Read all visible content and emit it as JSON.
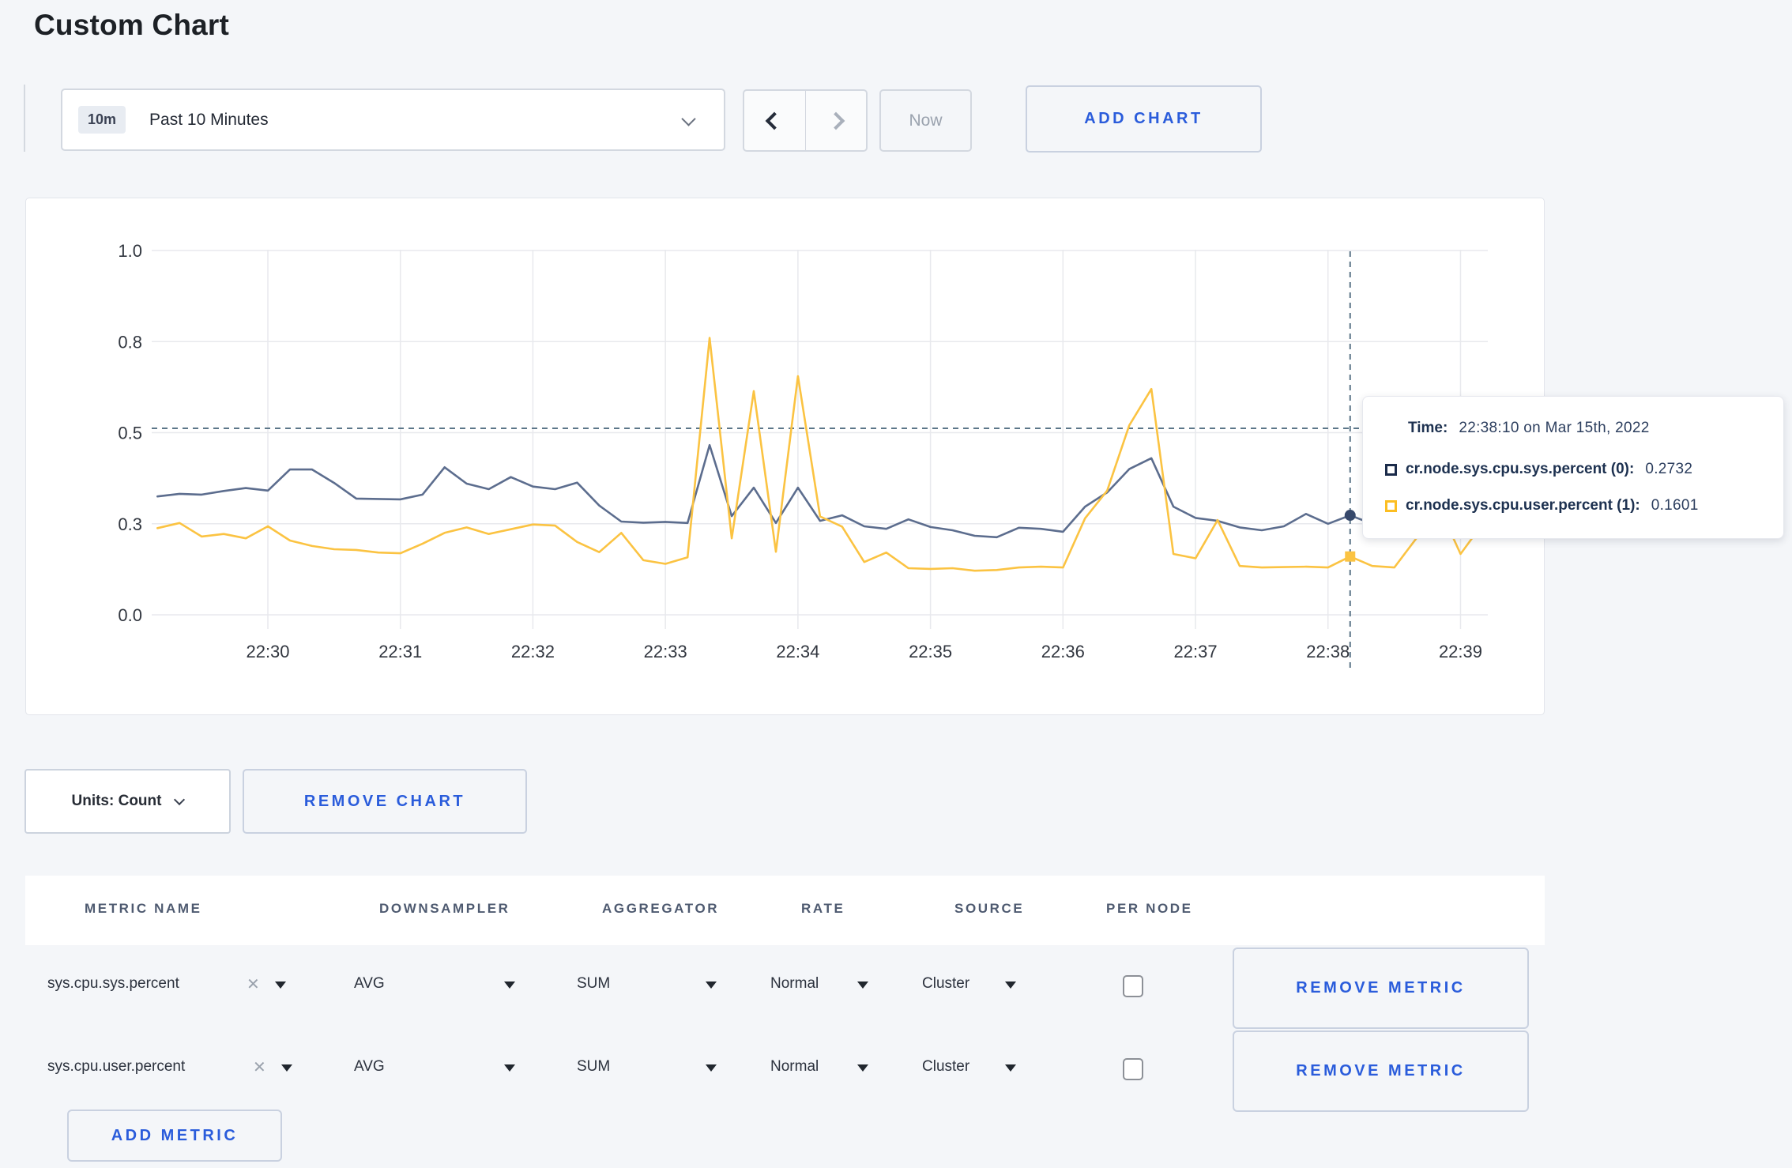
{
  "page": {
    "title": "Custom Chart"
  },
  "toolbar": {
    "time_window_badge": "10m",
    "time_window_label": "Past 10 Minutes",
    "prev_icon": "chevron-left-icon",
    "next_icon": "chevron-right-icon",
    "now_label": "Now",
    "add_chart_label": "ADD CHART"
  },
  "chart_data": {
    "type": "line",
    "title": "",
    "xlabel": "",
    "ylabel": "",
    "x_start_time": "22:29:10",
    "x_end_time": "22:39:10",
    "sample_interval_seconds": 10,
    "x_tick_labels": [
      "22:30",
      "22:31",
      "22:32",
      "22:33",
      "22:34",
      "22:35",
      "22:36",
      "22:37",
      "22:38",
      "22:39"
    ],
    "y_ticks": [
      {
        "label": "0.0",
        "value": 0.0
      },
      {
        "label": "0.3",
        "value": 0.25
      },
      {
        "label": "0.5",
        "value": 0.5
      },
      {
        "label": "0.8",
        "value": 0.75
      },
      {
        "label": "1.0",
        "value": 1.0
      }
    ],
    "ylim": [
      0,
      1
    ],
    "grid": true,
    "legend_position": "tooltip",
    "hover": {
      "index": 54,
      "time": "22:38:10",
      "crosshair_y_value": 0.512
    },
    "series": [
      {
        "name": "cr.node.sys.cpu.sys.percent (0)",
        "color": "#5c6d8e",
        "marker_color": "#36486b",
        "marker_shape": "circle",
        "hover_value": 0.2732,
        "values": [
          0.325,
          0.332,
          0.33,
          0.34,
          0.348,
          0.341,
          0.399,
          0.399,
          0.362,
          0.319,
          0.318,
          0.317,
          0.33,
          0.405,
          0.36,
          0.345,
          0.378,
          0.352,
          0.345,
          0.363,
          0.3,
          0.256,
          0.253,
          0.255,
          0.252,
          0.466,
          0.271,
          0.349,
          0.252,
          0.349,
          0.258,
          0.273,
          0.243,
          0.236,
          0.262,
          0.241,
          0.232,
          0.217,
          0.213,
          0.239,
          0.236,
          0.228,
          0.297,
          0.336,
          0.4,
          0.43,
          0.297,
          0.266,
          0.258,
          0.24,
          0.232,
          0.243,
          0.277,
          0.25,
          0.2732,
          0.25,
          0.268,
          0.288,
          0.3,
          0.29,
          0.308
        ]
      },
      {
        "name": "cr.node.sys.cpu.user.percent (1)",
        "color": "#fbc342",
        "marker_color": "#fbc342",
        "marker_shape": "square",
        "hover_value": 0.1601,
        "values": [
          0.238,
          0.252,
          0.215,
          0.222,
          0.21,
          0.243,
          0.204,
          0.189,
          0.18,
          0.178,
          0.171,
          0.169,
          0.195,
          0.225,
          0.24,
          0.222,
          0.235,
          0.248,
          0.245,
          0.2,
          0.172,
          0.225,
          0.15,
          0.14,
          0.158,
          0.76,
          0.21,
          0.614,
          0.173,
          0.655,
          0.27,
          0.242,
          0.145,
          0.171,
          0.128,
          0.126,
          0.128,
          0.121,
          0.123,
          0.13,
          0.132,
          0.13,
          0.265,
          0.341,
          0.52,
          0.62,
          0.167,
          0.155,
          0.26,
          0.134,
          0.13,
          0.131,
          0.132,
          0.13,
          0.1601,
          0.134,
          0.13,
          0.21,
          0.3,
          0.167,
          0.25
        ]
      }
    ]
  },
  "tooltip": {
    "time_label": "Time:",
    "time_value": "22:38:10 on Mar 15th, 2022",
    "rows": [
      {
        "label": "cr.node.sys.cpu.sys.percent (0):",
        "value": "0.2732",
        "legend_color": "#1b2b4a"
      },
      {
        "label": "cr.node.sys.cpu.user.percent (1):",
        "value": "0.1601",
        "legend_color": "#fcbe22"
      }
    ]
  },
  "chart_controls": {
    "units_label": "Units: Count",
    "remove_chart_label": "REMOVE CHART"
  },
  "metrics_table": {
    "headers": [
      "METRIC NAME",
      "DOWNSAMPLER",
      "AGGREGATOR",
      "RATE",
      "SOURCE",
      "PER NODE"
    ],
    "rows": [
      {
        "metric": "sys.cpu.sys.percent",
        "downsampler": "AVG",
        "aggregator": "SUM",
        "rate": "Normal",
        "source": "Cluster",
        "per_node_checked": false,
        "remove_label": "REMOVE METRIC"
      },
      {
        "metric": "sys.cpu.user.percent",
        "downsampler": "AVG",
        "aggregator": "SUM",
        "rate": "Normal",
        "source": "Cluster",
        "per_node_checked": false,
        "remove_label": "REMOVE METRIC"
      }
    ],
    "add_metric_label": "ADD METRIC"
  }
}
